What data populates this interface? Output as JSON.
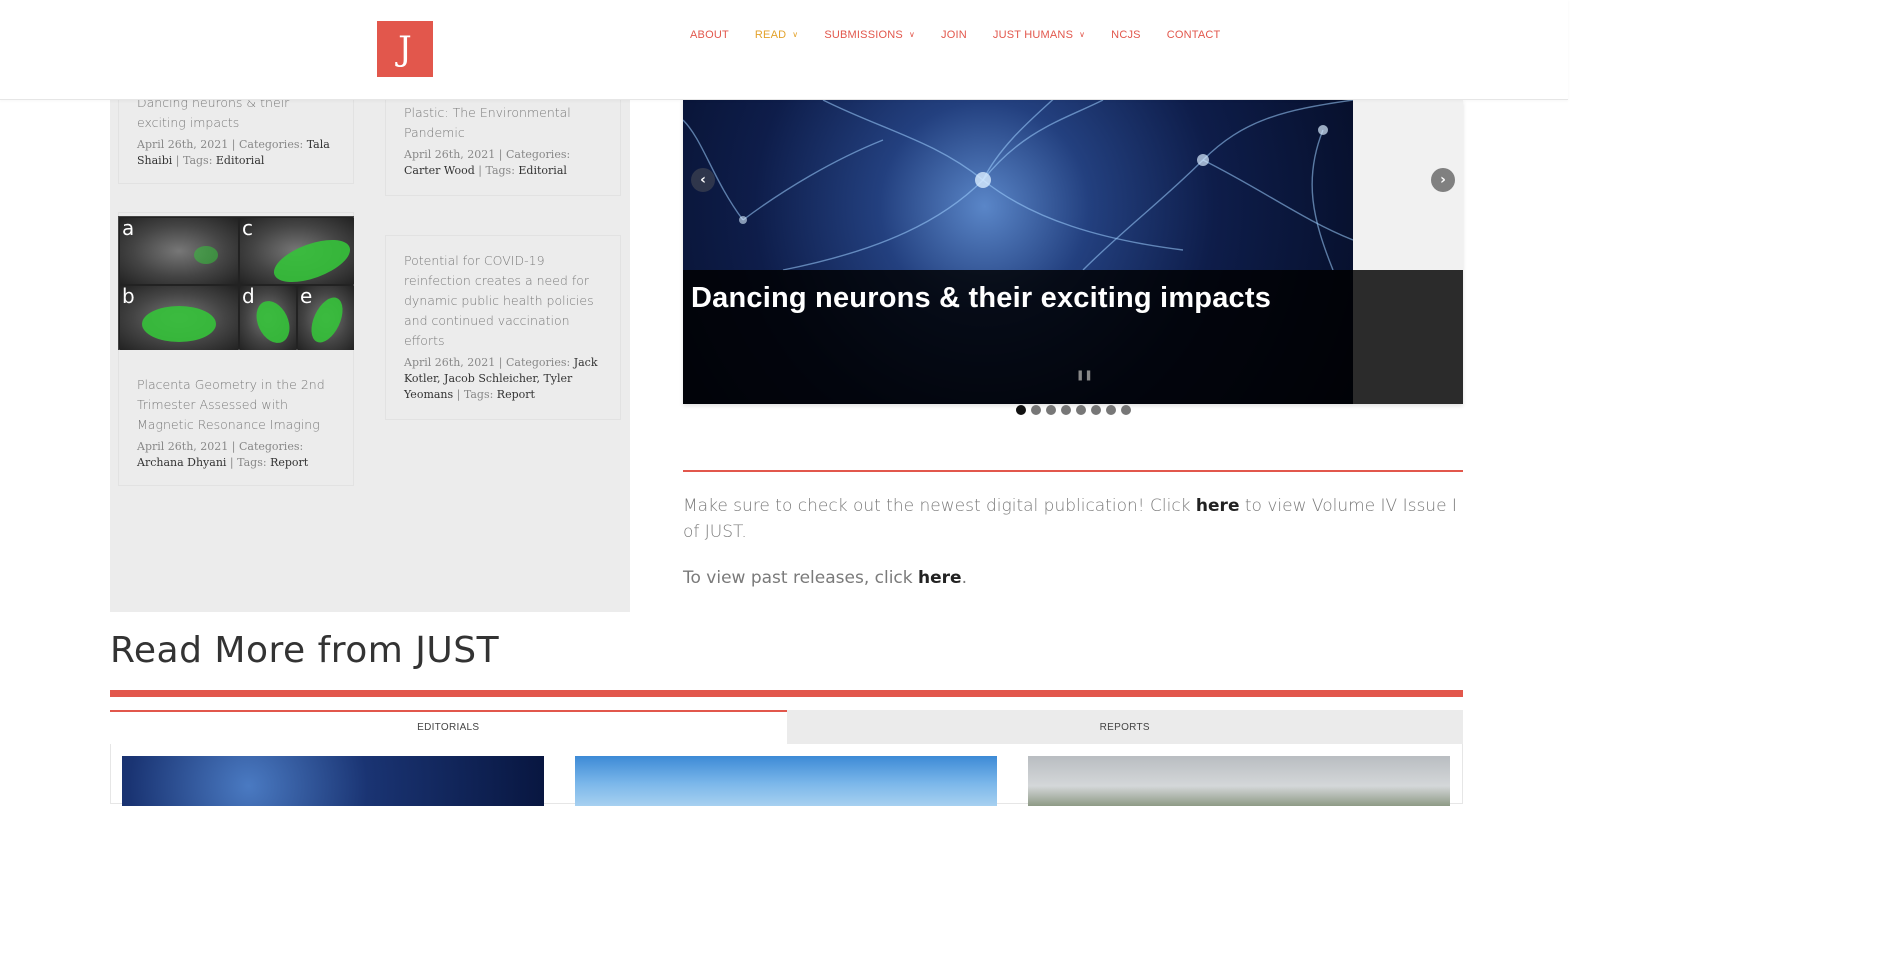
{
  "brand": {
    "logo_letter": "J",
    "accent": "#e2574c",
    "active_nav": "#e3a22b"
  },
  "nav": {
    "items": [
      {
        "label": "ABOUT",
        "dropdown": false,
        "active": false
      },
      {
        "label": "READ",
        "dropdown": true,
        "active": true
      },
      {
        "label": "SUBMISSIONS",
        "dropdown": true,
        "active": false
      },
      {
        "label": "JOIN",
        "dropdown": false,
        "active": false
      },
      {
        "label": "JUST HUMANS",
        "dropdown": true,
        "active": false
      },
      {
        "label": "NCJS",
        "dropdown": false,
        "active": false
      },
      {
        "label": "CONTACT",
        "dropdown": false,
        "active": false
      }
    ]
  },
  "posts": [
    {
      "title": "Dancing neurons & their exciting impacts",
      "date": "April 26th, 2021",
      "categories_label": "Categories:",
      "author": "Tala Shaibi",
      "tags_label": "Tags:",
      "tag": "Editorial"
    },
    {
      "title": "Plastic: The Environmental Pandemic",
      "date": "April 26th, 2021",
      "categories_label": "Categories:",
      "author": "Carter Wood",
      "tags_label": "Tags:",
      "tag": "Editorial"
    },
    {
      "title": "Placenta Geometry in the 2nd Trimester Assessed with Magnetic Resonance Imaging",
      "date": "April 26th, 2021",
      "categories_label": "Categories:",
      "author": "Archana Dhyani",
      "tags_label": "Tags:",
      "tag": "Report",
      "image_labels": [
        "a",
        "b",
        "c",
        "d",
        "e"
      ]
    },
    {
      "title": "Potential for COVID-19 reinfection creates a need for dynamic public health policies and continued vaccination efforts",
      "date": "April 26th, 2021",
      "categories_label": "Categories:",
      "author": "Jack Kotler, Jacob Schleicher, Tyler Yeomans",
      "tags_label": "Tags:",
      "tag": "Report"
    }
  ],
  "slider": {
    "caption": "Dancing neurons & their exciting impacts",
    "pause_icon": "pause-icon",
    "prev_icon": "chevron-left-icon",
    "next_icon": "chevron-right-icon",
    "slide_count": 8,
    "active_slide": 1
  },
  "notice": {
    "line1_pre": "Make sure to check out the newest digital publication! Click ",
    "line1_link": "here",
    "line1_post": " to view Volume IV Issue I of JUST.",
    "line2_pre": "To view past releases, click ",
    "line2_link": "here",
    "line2_post": "."
  },
  "read_more": {
    "heading": "Read More from JUST",
    "tabs": [
      {
        "label": "EDITORIALS",
        "active": true
      },
      {
        "label": "REPORTS",
        "active": false
      }
    ]
  }
}
